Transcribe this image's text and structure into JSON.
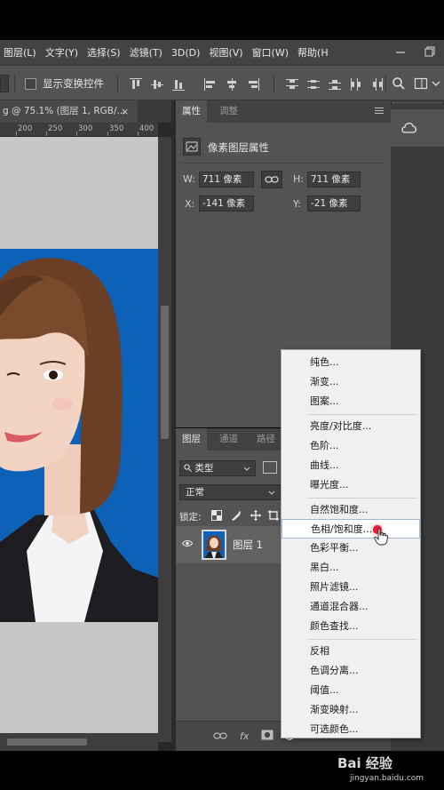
{
  "menubar": {
    "items": [
      "图层(L)",
      "文字(Y)",
      "选择(S)",
      "滤镜(T)",
      "3D(D)",
      "视图(V)",
      "窗口(W)",
      "帮助(H"
    ]
  },
  "options": {
    "show_transform_label": "显示变换控件",
    "show_transform_checked": false
  },
  "document": {
    "tab_title": "g @ 75.1% (图层 1, RGB/...",
    "close_glyph": "×",
    "ruler_ticks": [
      "200",
      "250",
      "300",
      "350",
      "400"
    ]
  },
  "properties": {
    "tabs": [
      "属性",
      "调整"
    ],
    "header": "像素图层属性",
    "w_label": "W:",
    "w_value": "711 像素",
    "h_label": "H:",
    "h_value": "711 像素",
    "x_label": "X:",
    "x_value": "-141 像素",
    "y_label": "Y:",
    "y_value": "-21 像素"
  },
  "layers": {
    "tabs": [
      "图层",
      "通道",
      "路径"
    ],
    "filter_label": "类型",
    "blend_mode": "正常",
    "lock_label": "锁定:",
    "items": [
      {
        "name": "图层 1",
        "visible": true
      }
    ],
    "footer_fx": "fx"
  },
  "context_menu": {
    "groups": [
      [
        "纯色...",
        "渐变...",
        "图案..."
      ],
      [
        "亮度/对比度...",
        "色阶...",
        "曲线...",
        "曝光度..."
      ],
      [
        "自然饱和度...",
        "色相/饱和度...",
        "色彩平衡...",
        "黑白...",
        "照片滤镜...",
        "通道混合器...",
        "颜色查找..."
      ],
      [
        "反相",
        "色调分离...",
        "阈值...",
        "渐变映射...",
        "可选颜色..."
      ]
    ],
    "highlighted": "色相/饱和度..."
  },
  "watermark": {
    "brand": "Bai 经验",
    "url": "jingyan.baidu.com"
  },
  "colors": {
    "panel": "#535353",
    "photo_background": "#0d62b8",
    "menu_background": "#f0f0f0",
    "pointer_marker": "#e41e3c"
  }
}
